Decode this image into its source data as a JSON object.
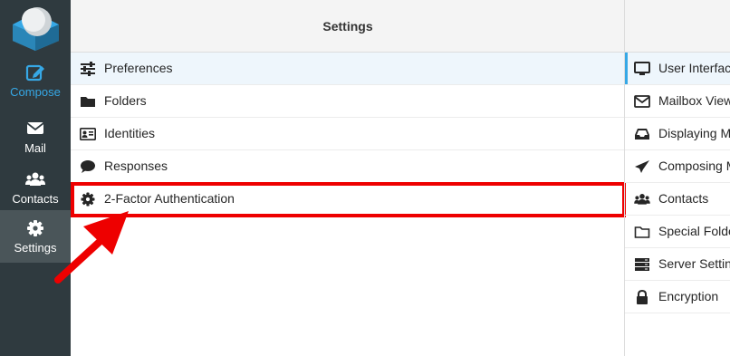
{
  "rail": {
    "compose_label": "Compose",
    "mail_label": "Mail",
    "contacts_label": "Contacts",
    "settings_label": "Settings"
  },
  "settings_column": {
    "title": "Settings",
    "items": [
      {
        "label": "Preferences",
        "icon": "sliders-icon"
      },
      {
        "label": "Folders",
        "icon": "folder-icon"
      },
      {
        "label": "Identities",
        "icon": "id-card-icon"
      },
      {
        "label": "Responses",
        "icon": "speech-bubble-icon"
      },
      {
        "label": "2-Factor Authentication",
        "icon": "gear-icon"
      }
    ]
  },
  "preferences_column": {
    "items": [
      {
        "label": "User Interface",
        "icon": "monitor-icon"
      },
      {
        "label": "Mailbox View",
        "icon": "envelope-icon"
      },
      {
        "label": "Displaying Messages",
        "icon": "inbox-icon"
      },
      {
        "label": "Composing Messages",
        "icon": "paper-plane-icon"
      },
      {
        "label": "Contacts",
        "icon": "users-icon"
      },
      {
        "label": "Special Folders",
        "icon": "folder-outline-icon"
      },
      {
        "label": "Server Settings",
        "icon": "server-icon"
      },
      {
        "label": "Encryption",
        "icon": "lock-icon"
      }
    ]
  },
  "colors": {
    "rail_bg": "#2f3a3f",
    "accent": "#36a8e6",
    "annotation": "#ee0000"
  }
}
